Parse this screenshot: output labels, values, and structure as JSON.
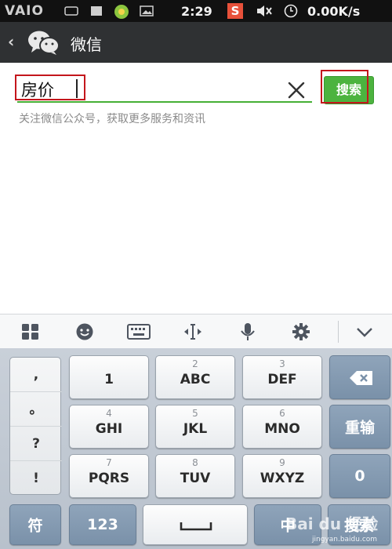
{
  "statusbar": {
    "brand": "VAIO",
    "time": "2:29",
    "sogou": "S",
    "speed": "0.00K/s"
  },
  "titlebar": {
    "back": "‹",
    "title": "微信",
    "icon": "wechat-logo-icon"
  },
  "search": {
    "value": "房价",
    "clear_icon": "close-icon",
    "button_label": "搜索",
    "hint": "关注微信公众号，获取更多服务和资讯",
    "accent": "#46b035",
    "highlight_color": "#c4161c"
  },
  "ime_toolbar": {
    "icons": [
      "grid-icon",
      "emoji-icon",
      "keyboard-icon",
      "cursor-icon",
      "mic-icon",
      "gear-icon",
      "chevron-down-icon"
    ]
  },
  "keyboard": {
    "punct": [
      ",",
      "。",
      "?",
      "!"
    ],
    "keys": [
      {
        "sub": "",
        "main": "1"
      },
      {
        "sub": "2",
        "main": "ABC"
      },
      {
        "sub": "3",
        "main": "DEF"
      },
      {
        "sub": "4",
        "main": "GHI"
      },
      {
        "sub": "5",
        "main": "JKL"
      },
      {
        "sub": "6",
        "main": "MNO"
      },
      {
        "sub": "7",
        "main": "PQRS"
      },
      {
        "sub": "8",
        "main": "TUV"
      },
      {
        "sub": "9",
        "main": "WXYZ"
      }
    ],
    "backspace_icon": "backspace-icon",
    "reenter": "重输",
    "zero": "0",
    "symbol": "符",
    "num": "123",
    "space_icon": "space-icon",
    "lang": "中",
    "search_key": "搜索",
    "watermark": "Bai du 经验",
    "watermark_sub": "jingyan.baidu.com"
  }
}
